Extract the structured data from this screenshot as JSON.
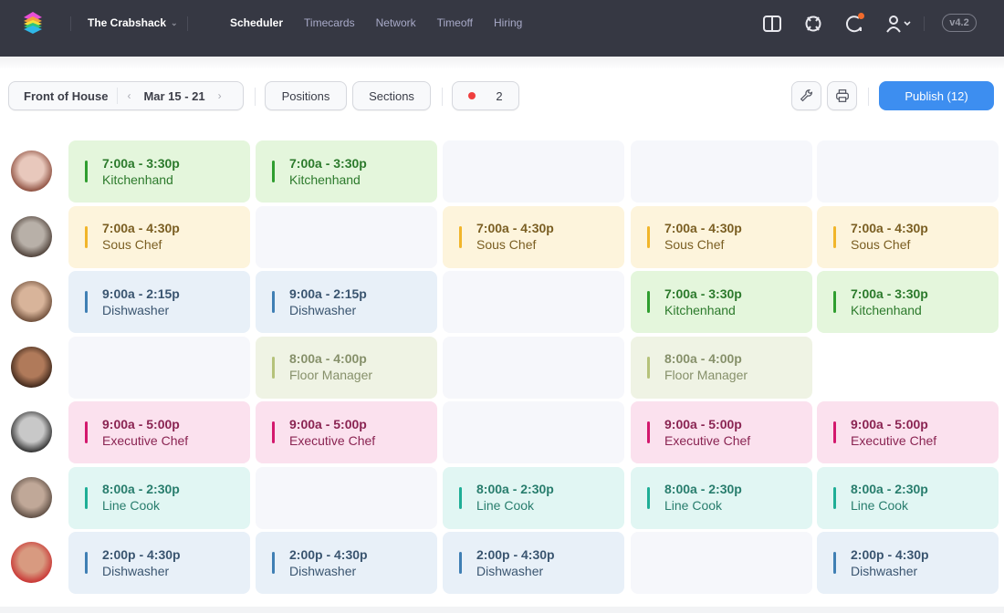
{
  "header": {
    "org_name": "The Crabshack",
    "nav": [
      {
        "label": "Scheduler",
        "active": true
      },
      {
        "label": "Timecards",
        "active": false
      },
      {
        "label": "Network",
        "active": false
      },
      {
        "label": "Timeoff",
        "active": false
      },
      {
        "label": "Hiring",
        "active": false
      }
    ],
    "icons": [
      "book-icon",
      "help-lifebuoy-icon",
      "notifications-icon",
      "user-menu-icon"
    ],
    "version": "v4.2"
  },
  "toolbar": {
    "location": "Front of House",
    "date_range": "Mar 15 - 21",
    "positions_label": "Positions",
    "sections_label": "Sections",
    "alert_count": "2",
    "publish_label": "Publish (12)"
  },
  "colors": {
    "accent": "#3d8ef0",
    "topbar": "#363843",
    "alert_dot": "#ef3e3e",
    "notification_dot": "#f26b2c"
  },
  "schedule": {
    "rows": [
      {
        "employee": "employee-1",
        "shifts": [
          {
            "time": "7:00a - 3:30p",
            "role": "Kitchenhand",
            "type": "kitchen"
          },
          {
            "time": "7:00a - 3:30p",
            "role": "Kitchenhand",
            "type": "kitchen"
          },
          null,
          null,
          null
        ]
      },
      {
        "employee": "employee-2",
        "shifts": [
          {
            "time": "7:00a - 4:30p",
            "role": "Sous Chef",
            "type": "sous"
          },
          null,
          {
            "time": "7:00a - 4:30p",
            "role": "Sous Chef",
            "type": "sous"
          },
          {
            "time": "7:00a - 4:30p",
            "role": "Sous Chef",
            "type": "sous"
          },
          {
            "time": "7:00a - 4:30p",
            "role": "Sous Chef",
            "type": "sous"
          }
        ]
      },
      {
        "employee": "employee-3",
        "shifts": [
          {
            "time": "9:00a - 2:15p",
            "role": "Dishwasher",
            "type": "dish"
          },
          {
            "time": "9:00a - 2:15p",
            "role": "Dishwasher",
            "type": "dish"
          },
          null,
          {
            "time": "7:00a - 3:30p",
            "role": "Kitchenhand",
            "type": "kitchen"
          },
          {
            "time": "7:00a - 3:30p",
            "role": "Kitchenhand",
            "type": "kitchen"
          }
        ]
      },
      {
        "employee": "employee-4",
        "shifts": [
          null,
          {
            "time": "8:00a - 4:00p",
            "role": "Floor Manager",
            "type": "floor"
          },
          null,
          {
            "time": "8:00a - 4:00p",
            "role": "Floor Manager",
            "type": "floor"
          },
          null
        ]
      },
      {
        "employee": "employee-5",
        "shifts": [
          {
            "time": "9:00a - 5:00p",
            "role": "Executive Chef",
            "type": "exec"
          },
          {
            "time": "9:00a - 5:00p",
            "role": "Executive Chef",
            "type": "exec"
          },
          null,
          {
            "time": "9:00a - 5:00p",
            "role": "Executive Chef",
            "type": "exec"
          },
          {
            "time": "9:00a - 5:00p",
            "role": "Executive Chef",
            "type": "exec"
          }
        ]
      },
      {
        "employee": "employee-6",
        "shifts": [
          {
            "time": "8:00a - 2:30p",
            "role": "Line Cook",
            "type": "line"
          },
          null,
          {
            "time": "8:00a - 2:30p",
            "role": "Line Cook",
            "type": "line"
          },
          {
            "time": "8:00a - 2:30p",
            "role": "Line Cook",
            "type": "line"
          },
          {
            "time": "8:00a - 2:30p",
            "role": "Line Cook",
            "type": "line"
          }
        ]
      },
      {
        "employee": "employee-7",
        "shifts": [
          {
            "time": "2:00p - 4:30p",
            "role": "Dishwasher",
            "type": "dish"
          },
          {
            "time": "2:00p - 4:30p",
            "role": "Dishwasher",
            "type": "dish"
          },
          {
            "time": "2:00p - 4:30p",
            "role": "Dishwasher",
            "type": "dish"
          },
          null,
          {
            "time": "2:00p - 4:30p",
            "role": "Dishwasher",
            "type": "dish"
          }
        ]
      }
    ]
  }
}
